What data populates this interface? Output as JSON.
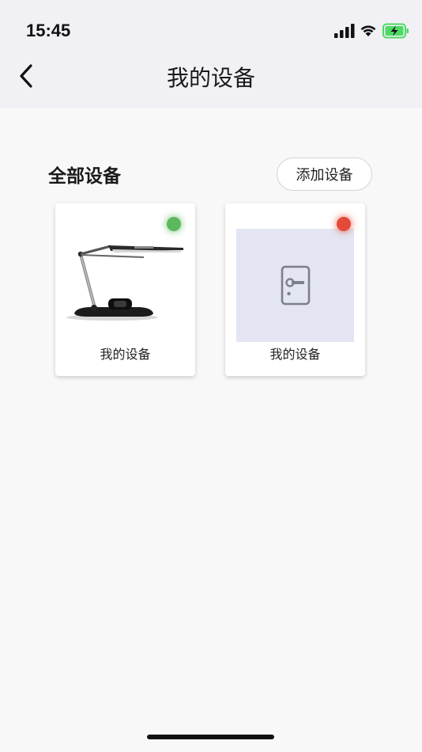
{
  "status_bar": {
    "time": "15:45",
    "icons": [
      "signal-icon",
      "wifi-icon",
      "battery-charging-icon"
    ],
    "battery_color": "#4cd964"
  },
  "nav": {
    "back_icon": "chevron-left-icon",
    "title": "我的设备"
  },
  "section": {
    "title": "全部设备",
    "add_button_label": "添加设备"
  },
  "devices": [
    {
      "label": "我的设备",
      "image": "desk-lamp",
      "status": "online",
      "status_color": "#5cb85c"
    },
    {
      "label": "我的设备",
      "image": "door-lock-placeholder",
      "status": "offline",
      "status_color": "#e5493a"
    }
  ]
}
